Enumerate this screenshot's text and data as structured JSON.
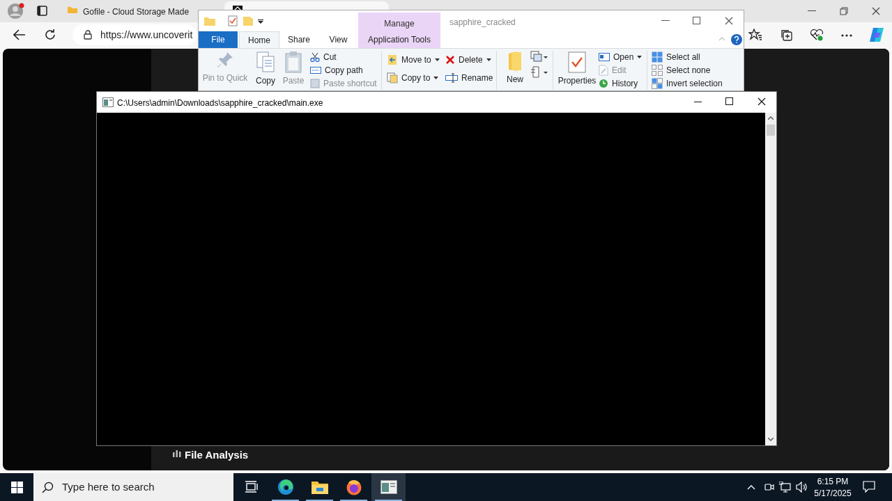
{
  "browser": {
    "tabs": [
      {
        "title": "Gofile - Cloud Storage Made",
        "selected": false
      },
      {
        "selected": true
      }
    ],
    "address": "https://www.uncoverit"
  },
  "background_page": {
    "section": "File Analysis"
  },
  "explorer": {
    "context_tab": "Manage",
    "title": "sapphire_cracked",
    "tabs": [
      {
        "label": "File",
        "kind": "file",
        "selected": false
      },
      {
        "label": "Home",
        "kind": "tab",
        "selected": true
      },
      {
        "label": "Share",
        "kind": "tab",
        "selected": false
      },
      {
        "label": "View",
        "kind": "tab",
        "selected": false
      },
      {
        "label": "Application Tools",
        "kind": "context",
        "selected": false
      }
    ],
    "ribbon": [
      {
        "label": "Pin to Quick",
        "kind": "large",
        "disabled": true
      },
      {
        "label": "Copy",
        "kind": "large",
        "disabled": false
      },
      {
        "label": "Paste",
        "kind": "large",
        "disabled": true
      },
      {
        "label": "Cut",
        "kind": "small",
        "disabled": false
      },
      {
        "label": "Copy path",
        "kind": "small",
        "disabled": false
      },
      {
        "label": "Paste shortcut",
        "kind": "small",
        "disabled": true
      },
      {
        "label": "Move to",
        "kind": "medium",
        "dropdown": true,
        "disabled": false
      },
      {
        "label": "Copy to",
        "kind": "medium",
        "dropdown": true,
        "disabled": false
      },
      {
        "label": "Delete",
        "kind": "medium",
        "dropdown": true,
        "disabled": false
      },
      {
        "label": "Rename",
        "kind": "medium",
        "dropdown": false,
        "disabled": false
      },
      {
        "label": "New",
        "kind": "large",
        "disabled": false
      },
      {
        "label": "Properties",
        "kind": "large",
        "disabled": false
      },
      {
        "label": "Open",
        "kind": "small",
        "dropdown": true,
        "disabled": false
      },
      {
        "label": "Edit",
        "kind": "small",
        "dropdown": false,
        "disabled": true
      },
      {
        "label": "History",
        "kind": "small",
        "dropdown": false,
        "disabled": false
      },
      {
        "label": "Select all",
        "kind": "small",
        "dropdown": false,
        "disabled": false
      },
      {
        "label": "Select none",
        "kind": "small",
        "dropdown": false,
        "disabled": false
      },
      {
        "label": "Invert selection",
        "kind": "small",
        "dropdown": false,
        "disabled": false
      }
    ]
  },
  "console": {
    "title": "C:\\Users\\admin\\Downloads\\sapphire_cracked\\main.exe"
  },
  "taskbar": {
    "search_placeholder": "Type here to search",
    "apps": [
      {
        "kind": "taskview",
        "running": false,
        "selected": false
      },
      {
        "kind": "edge",
        "running": true,
        "selected": false
      },
      {
        "kind": "explorer",
        "running": true,
        "selected": false
      },
      {
        "kind": "firefox",
        "running": true,
        "selected": false
      },
      {
        "kind": "console",
        "running": true,
        "selected": true
      }
    ],
    "time": "6:15 PM",
    "date": "5/17/2025"
  }
}
